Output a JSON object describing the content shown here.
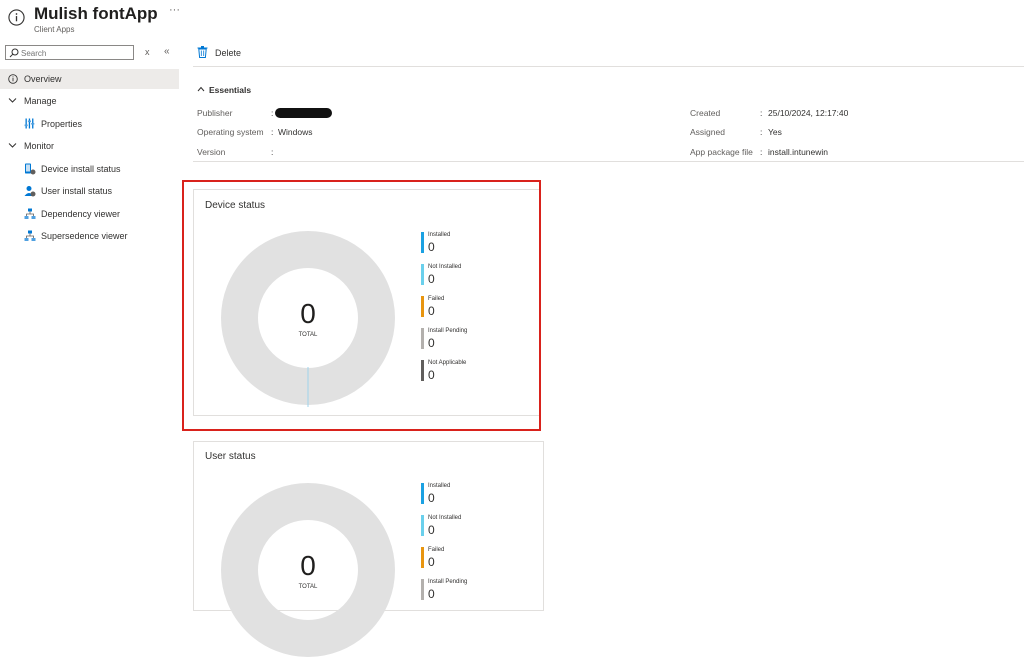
{
  "header": {
    "title": "Mulish fontApp",
    "subtitle": "Client Apps",
    "more": "···"
  },
  "sidebar": {
    "search_placeholder": "Search",
    "clear": "x",
    "collapse": "«",
    "items": [
      {
        "label": "Overview"
      },
      {
        "label": "Manage"
      },
      {
        "label": "Properties"
      },
      {
        "label": "Monitor"
      },
      {
        "label": "Device install status"
      },
      {
        "label": "User install status"
      },
      {
        "label": "Dependency viewer"
      },
      {
        "label": "Supersedence viewer"
      }
    ]
  },
  "toolbar": {
    "delete_label": "Delete"
  },
  "essentials": {
    "title": "Essentials",
    "left": [
      {
        "label": "Publisher",
        "sep": ":",
        "value": ""
      },
      {
        "label": "Operating system",
        "sep": ":",
        "value": "Windows"
      },
      {
        "label": "Version",
        "sep": ":",
        "value": ""
      }
    ],
    "right": [
      {
        "label": "Created",
        "sep": ":",
        "value": "25/10/2024, 12:17:40"
      },
      {
        "label": "Assigned",
        "sep": ":",
        "value": "Yes"
      },
      {
        "label": "App package file",
        "sep": ":",
        "value": "install.intunewin"
      }
    ]
  },
  "device_status": {
    "title": "Device status",
    "total": "0",
    "total_label": "TOTAL",
    "legend": [
      {
        "label": "Installed",
        "value": "0",
        "color": "#1ba1e2"
      },
      {
        "label": "Not Installed",
        "value": "0",
        "color": "#6ad0ec"
      },
      {
        "label": "Failed",
        "value": "0",
        "color": "#e8950f"
      },
      {
        "label": "Install Pending",
        "value": "0",
        "color": "#b3b0ad"
      },
      {
        "label": "Not Applicable",
        "value": "0",
        "color": "#605e5c"
      }
    ]
  },
  "user_status": {
    "title": "User status",
    "total": "0",
    "total_label": "TOTAL",
    "legend": [
      {
        "label": "Installed",
        "value": "0",
        "color": "#1ba1e2"
      },
      {
        "label": "Not Installed",
        "value": "0",
        "color": "#6ad0ec"
      },
      {
        "label": "Failed",
        "value": "0",
        "color": "#e8950f"
      },
      {
        "label": "Install Pending",
        "value": "0",
        "color": "#b3b0ad"
      }
    ]
  },
  "colors": {
    "donut": "#e1e1e1",
    "highlight": "#d9221c",
    "accent": "#0078d4"
  }
}
